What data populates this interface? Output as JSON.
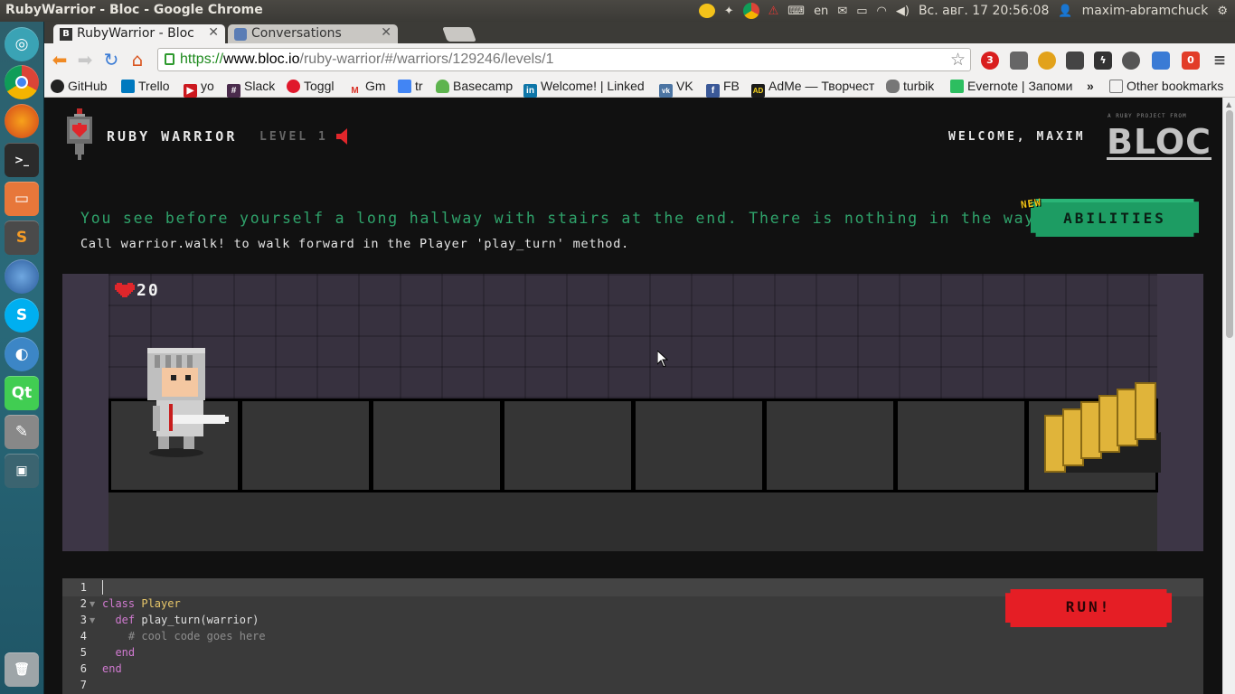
{
  "window": {
    "title": "RubyWarrior - Bloc - Google Chrome"
  },
  "system_tray": {
    "keyboard_layout": "en",
    "datetime": "Вс. авг. 17 20:56:08",
    "user": "maxim-abramchuck"
  },
  "tabs": [
    {
      "label": "RubyWarrior - Bloc",
      "favicon": "B",
      "active": true
    },
    {
      "label": "Conversations",
      "active": false
    }
  ],
  "omnibox": {
    "scheme": "https://",
    "host": "www.bloc.io",
    "path": "/ruby-warrior/#/warriors/129246/levels/1"
  },
  "extensions": [
    {
      "name": "adblock-icon",
      "badge": "3",
      "color": "#d91e1e"
    },
    {
      "name": "eyedropper-icon",
      "color": "#666666"
    },
    {
      "name": "flower-icon",
      "color": "#e2a21b"
    },
    {
      "name": "owl-icon",
      "color": "#444444"
    },
    {
      "name": "lightning-icon",
      "color": "#333333"
    },
    {
      "name": "cloud-upload-icon",
      "color": "#555555"
    },
    {
      "name": "code-icon",
      "color": "#3a7bd5"
    },
    {
      "name": "todoist-icon",
      "badge": "0",
      "color": "#e23d28"
    }
  ],
  "bookmarks": [
    {
      "label": "GitHub",
      "icon": "github-icon",
      "color": "#222222"
    },
    {
      "label": "Trello",
      "icon": "trello-icon",
      "color": "#0079bf"
    },
    {
      "label": "yo",
      "icon": "youtube-icon",
      "color": "#cc181e"
    },
    {
      "label": "Slack",
      "icon": "slack-icon",
      "color": "#4a2b4c"
    },
    {
      "label": "Toggl",
      "icon": "toggl-icon",
      "color": "#e0182b"
    },
    {
      "label": "Gm",
      "icon": "gmail-icon",
      "color": "#d93025"
    },
    {
      "label": "tr",
      "icon": "translate-icon",
      "color": "#4285f4"
    },
    {
      "label": "Basecamp",
      "icon": "basecamp-icon",
      "color": "#5eb44e"
    },
    {
      "label": "Welcome! | Linked",
      "icon": "linkedin-icon",
      "color": "#0e76a8"
    },
    {
      "label": "VK",
      "icon": "vk-icon",
      "color": "#4c75a3"
    },
    {
      "label": "FB",
      "icon": "facebook-icon",
      "color": "#3b5998"
    },
    {
      "label": "AdMe — Творчест",
      "icon": "adme-icon",
      "color": "#1b1b1b"
    },
    {
      "label": "turbik",
      "icon": "turbik-icon",
      "color": "#666666"
    },
    {
      "label": "Evernote | Запоми",
      "icon": "evernote-icon",
      "color": "#2dbe60"
    }
  ],
  "bookmarks_more": "»",
  "other_bookmarks": "Other bookmarks",
  "header": {
    "game_name": "RUBY WARRIOR",
    "level": "LEVEL 1",
    "welcome": "WELCOME, MAXIM",
    "bloc_tagline": "A RUBY PROJECT FROM",
    "bloc_logo": "BLOC"
  },
  "level": {
    "description": "You see before yourself a long hallway with stairs at the end. There is nothing in the way.",
    "tip": "Call warrior.walk! to walk forward in the Player 'play_turn' method."
  },
  "abilities": {
    "badge": "NEW",
    "label": "ABILITIES"
  },
  "board": {
    "health": "20",
    "tiles": 8,
    "warrior_tile": 1,
    "stairs_tile": 8
  },
  "editor": {
    "line_numbers": [
      "1",
      "2",
      "3",
      "4",
      "5",
      "6",
      "7"
    ],
    "run_label": "RUN!"
  },
  "colors": {
    "accent_green": "#2fa36b",
    "run_red": "#e51e25",
    "page_bg": "#111111"
  }
}
